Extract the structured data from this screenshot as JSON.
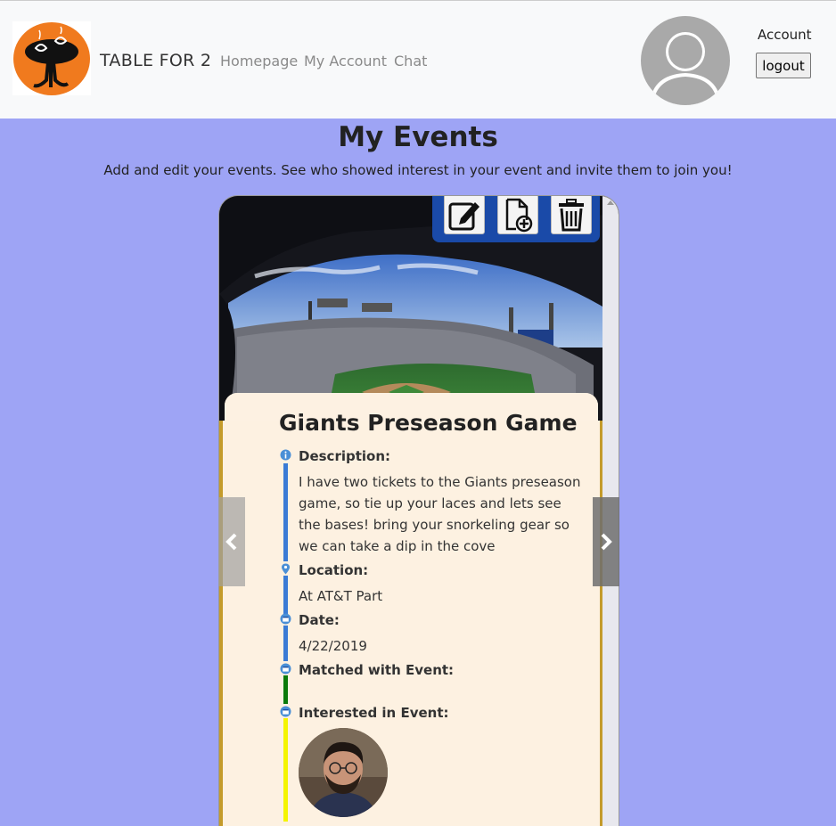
{
  "navbar": {
    "brand": "TABLE FOR 2",
    "links": [
      "Homepage",
      "My Account",
      "Chat"
    ],
    "account_label": "Account",
    "logout_label": "logout"
  },
  "header": {
    "title": "My Events",
    "subtitle": "Add and edit your events. See who showed interest in your event and invite them to join you!"
  },
  "event": {
    "title": "Giants Preseason Game",
    "description_label": "Description:",
    "description": " I have two tickets to the Giants preseason game, so tie up your laces and lets see the bases! bring your snorkeling gear so we can take a dip in the cove",
    "location_label": "Location:",
    "location": "At AT&T Part",
    "date_label": "Date:",
    "date": "4/22/2019",
    "matched_label": "Matched with Event:",
    "interested_label": "Interested in Event:"
  },
  "toolbar": {
    "icons": [
      "edit-icon",
      "add-file-icon",
      "trash-icon"
    ]
  },
  "colors": {
    "page_bg": "#9ea4f5",
    "navbar_bg": "#f8f9fa",
    "toolbar_bg": "#1a4aa8",
    "card_bg": "#fdf1e1",
    "timeline_blue": "#3a7bd5",
    "timeline_green": "#0a7a0a",
    "timeline_yellow": "#f4f400",
    "logo_orange": "#f07a1e"
  }
}
